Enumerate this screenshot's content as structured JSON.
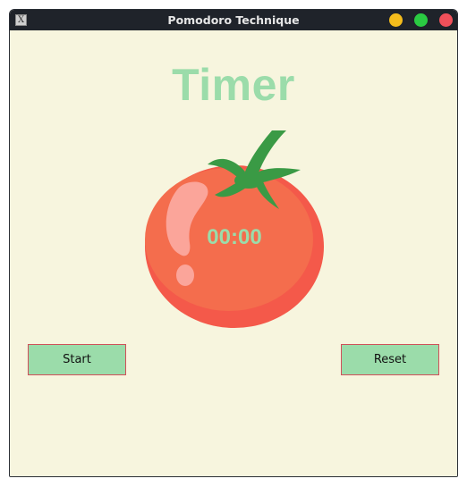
{
  "window": {
    "title": "Pomodoro Technique",
    "app_icon": "X",
    "controls": {
      "minimize_color": "#f4bc1c",
      "maximize_color": "#2acb42",
      "close_color": "#f0505a"
    }
  },
  "app": {
    "heading": "Timer",
    "timer": "00:00",
    "start_label": "Start",
    "reset_label": "Reset",
    "accent_color": "#9bdcaa",
    "background_color": "#f7f5de",
    "image": "tomato-icon"
  }
}
